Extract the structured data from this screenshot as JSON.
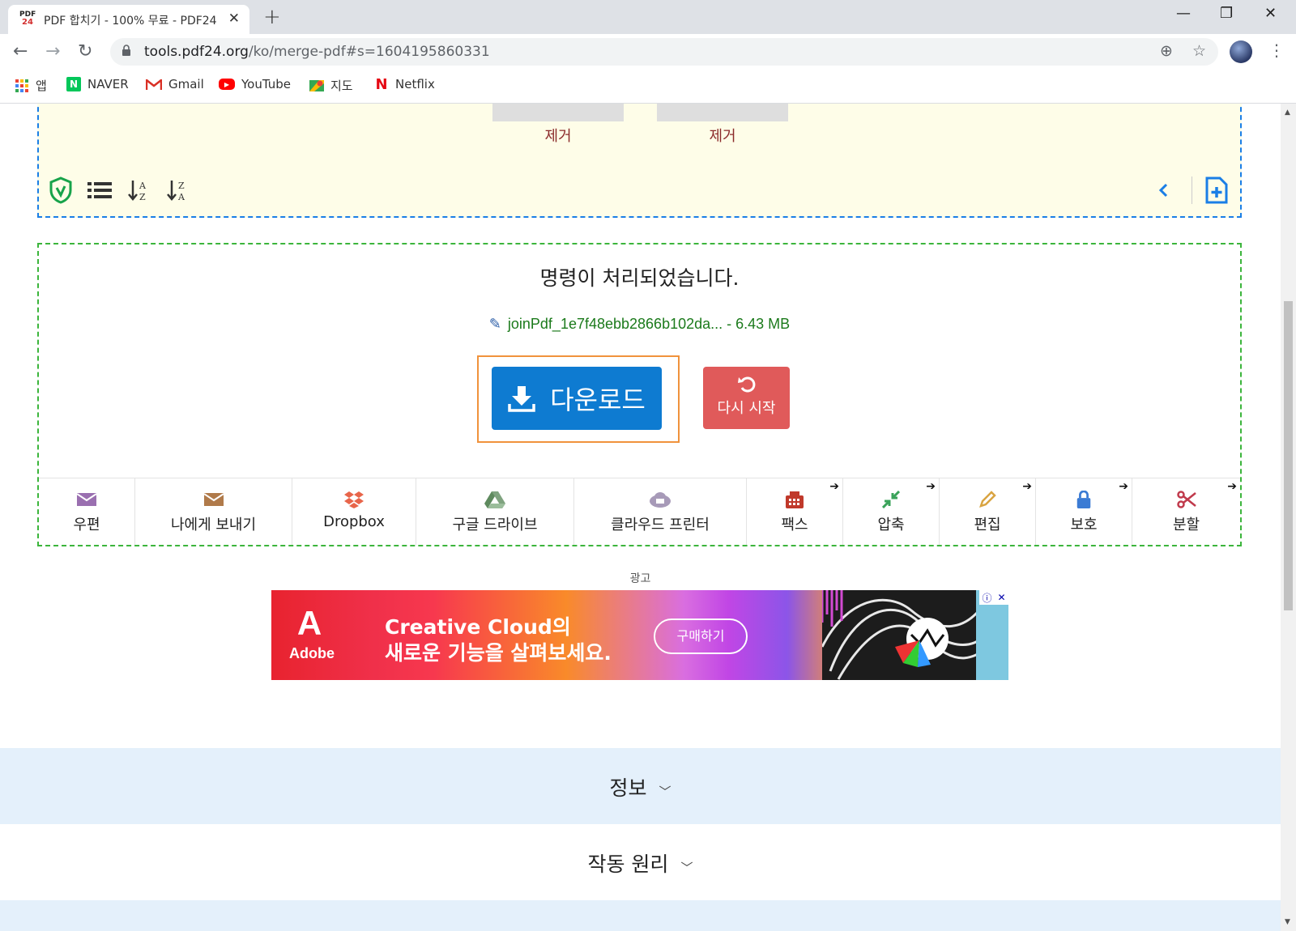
{
  "browser": {
    "tab_title": "PDF 합치기 - 100% 무료 - PDF24",
    "favicon_top": "PDF",
    "favicon_bottom": "24",
    "url_host": "tools.pdf24.org",
    "url_path": "/ko/merge-pdf#s=1604195860331",
    "bookmarks": [
      {
        "label": "앱",
        "icon": "apps-grid-icon"
      },
      {
        "label": "NAVER",
        "icon": "naver-icon"
      },
      {
        "label": "Gmail",
        "icon": "gmail-icon"
      },
      {
        "label": "YouTube",
        "icon": "youtube-icon"
      },
      {
        "label": "지도",
        "icon": "maps-icon"
      },
      {
        "label": "Netflix",
        "icon": "netflix-icon"
      }
    ]
  },
  "files": {
    "remove_label_1": "제거",
    "remove_label_2": "제거"
  },
  "result": {
    "message": "명령이 처리되었습니다.",
    "file_name": "joinPdf_1e7f48ebb2866b102da...",
    "file_size": "- 6.43 MB",
    "download_label": "다운로드",
    "restart_label": "다시 시작"
  },
  "actions": [
    {
      "label": "우편",
      "icon": "envelope-icon",
      "arrow": false
    },
    {
      "label": "나에게 보내기",
      "icon": "envelope-icon",
      "arrow": false
    },
    {
      "label": "Dropbox",
      "icon": "dropbox-icon",
      "arrow": false
    },
    {
      "label": "구글 드라이브",
      "icon": "google-drive-icon",
      "arrow": false
    },
    {
      "label": "클라우드 프린터",
      "icon": "cloud-printer-icon",
      "arrow": false
    },
    {
      "label": "팩스",
      "icon": "fax-icon",
      "arrow": true
    },
    {
      "label": "압축",
      "icon": "compress-icon",
      "arrow": true
    },
    {
      "label": "편집",
      "icon": "pencil-icon",
      "arrow": true
    },
    {
      "label": "보호",
      "icon": "lock-icon",
      "arrow": true
    },
    {
      "label": "분할",
      "icon": "scissors-icon",
      "arrow": true
    }
  ],
  "ad": {
    "label": "광고",
    "brand": "Adobe",
    "headline_1": "Creative Cloud의",
    "headline_2": "새로운 기능을 살펴보세요.",
    "cta": "구매하기"
  },
  "sections": {
    "info": "정보",
    "how": "작동 원리"
  },
  "colors": {
    "download": "#0e7bd1",
    "restart": "#e05a5a",
    "result_border": "#3cb53c",
    "files_border": "#1a7ee6"
  }
}
